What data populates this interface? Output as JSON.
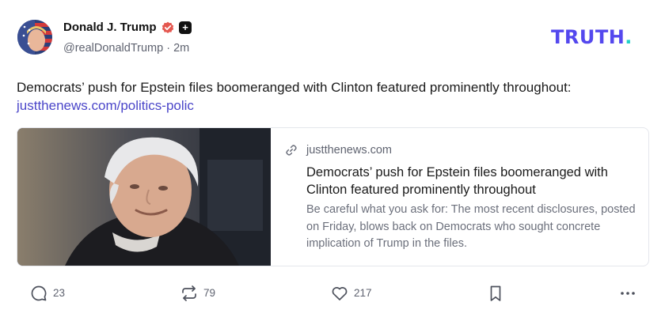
{
  "author": {
    "display_name": "Donald J. Trump",
    "handle": "@realDonaldTrump",
    "separator": "·",
    "time": "2m",
    "verified_icon": "verified-badge-icon",
    "badge_icon": "plus-icon",
    "badge_symbol": "+"
  },
  "brand": {
    "logo_text": "TRUTH",
    "logo_dot": ".",
    "color": "#5448ee",
    "dot_color": "#21d1c7"
  },
  "post": {
    "text": "Democrats’ push for Epstein files boomeranged with Clinton featured prominently throughout:",
    "link": "justthenews.com/politics-polic",
    "link_color": "#4b46c9"
  },
  "card": {
    "domain": "justthenews.com",
    "title": "Democrats’ push for Epstein files boomeranged with Clinton featured prominently throughout",
    "description": "Be careful what you ask for: The most recent disclosures, posted on Friday, blows back on Democrats who sought concrete implication of Trump in the files.",
    "image": "news-photo"
  },
  "actions": {
    "reply": {
      "icon": "reply-icon",
      "count": "23"
    },
    "retruth": {
      "icon": "retruth-icon",
      "count": "79"
    },
    "like": {
      "icon": "heart-icon",
      "count": "217"
    },
    "bookmark": {
      "icon": "bookmark-icon"
    },
    "more": {
      "icon": "more-icon"
    }
  }
}
